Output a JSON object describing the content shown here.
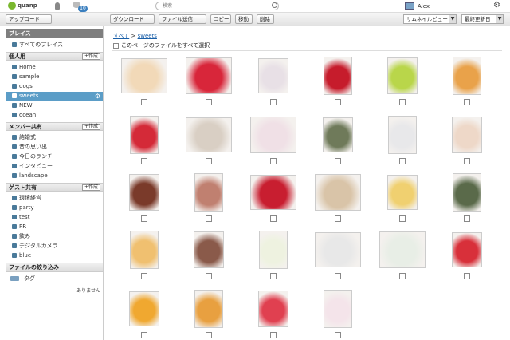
{
  "topbar": {
    "logo_text": "quanp",
    "notif_count": "10",
    "search_placeholder": "検索",
    "user_name": "Alex"
  },
  "toolbar": {
    "upload_label": "アップロード",
    "download_label": "ダウンロード",
    "send_label": "ファイル送信",
    "copy_label": "コピー",
    "move_label": "移動",
    "delete_label": "削除",
    "view_select": "サムネイルビュー",
    "sort_select": "最終更新日"
  },
  "sidebar": {
    "places_header": "プレイス",
    "all_places": "すべてのプレイス",
    "personal": {
      "title": "個人用",
      "create": "+作成",
      "items": [
        "Home",
        "sample",
        "dogs",
        "sweets",
        "NEW",
        "ocean"
      ]
    },
    "member": {
      "title": "メンバー共有",
      "create": "+作成",
      "items": [
        "結婚式",
        "昔の思い出",
        "今日のランチ",
        "インタビュー",
        "landscape"
      ]
    },
    "guest": {
      "title": "ゲスト共有",
      "create": "+作成",
      "items": [
        "環境経営",
        "party",
        "test",
        "PR",
        "飲み",
        "デジタルカメラ",
        "blue"
      ]
    },
    "filter_header": "ファイルの絞り込み",
    "tag_label": "タグ",
    "no_match": "ありません"
  },
  "main": {
    "crumb_all": "すべて",
    "crumb_sep": ">",
    "crumb_current": "sweets",
    "select_all": "このページのファイルをすべて選択"
  },
  "colors": [
    "#f2d9b8",
    "#d8263a",
    "#e8e0e6",
    "#c61c2c",
    "#b9d64a",
    "#e9a24a",
    "#d42a38",
    "#d9cfc4",
    "#f0e0e6",
    "#6f7a5a",
    "#e8e8ea",
    "#eed8c8",
    "#7a3a2a",
    "#c08070",
    "#c81e30",
    "#d9c4a8",
    "#f0d070",
    "#5a6a4a",
    "#f0c070",
    "#8a5a4a",
    "#eef2e0",
    "#e8e8e8",
    "#e8eee6",
    "#d8303a",
    "#f0a830",
    "#e8a040",
    "#e04050",
    "#f4e4ea"
  ]
}
